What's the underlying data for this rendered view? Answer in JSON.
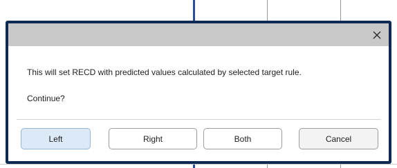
{
  "dialog": {
    "message": "This will set RECD with predicted values calculated by selected target rule.",
    "question": "Continue?",
    "close_icon": "close-icon"
  },
  "buttons": {
    "left": "Left",
    "right": "Right",
    "both": "Both",
    "cancel": "Cancel"
  },
  "colors": {
    "dialog_border": "#0e2a52",
    "titlebar": "#c8c8c8",
    "primary_button_bg": "#dceaf7",
    "primary_button_border": "#96b7d8",
    "background_axis": "#2a4d9a"
  }
}
